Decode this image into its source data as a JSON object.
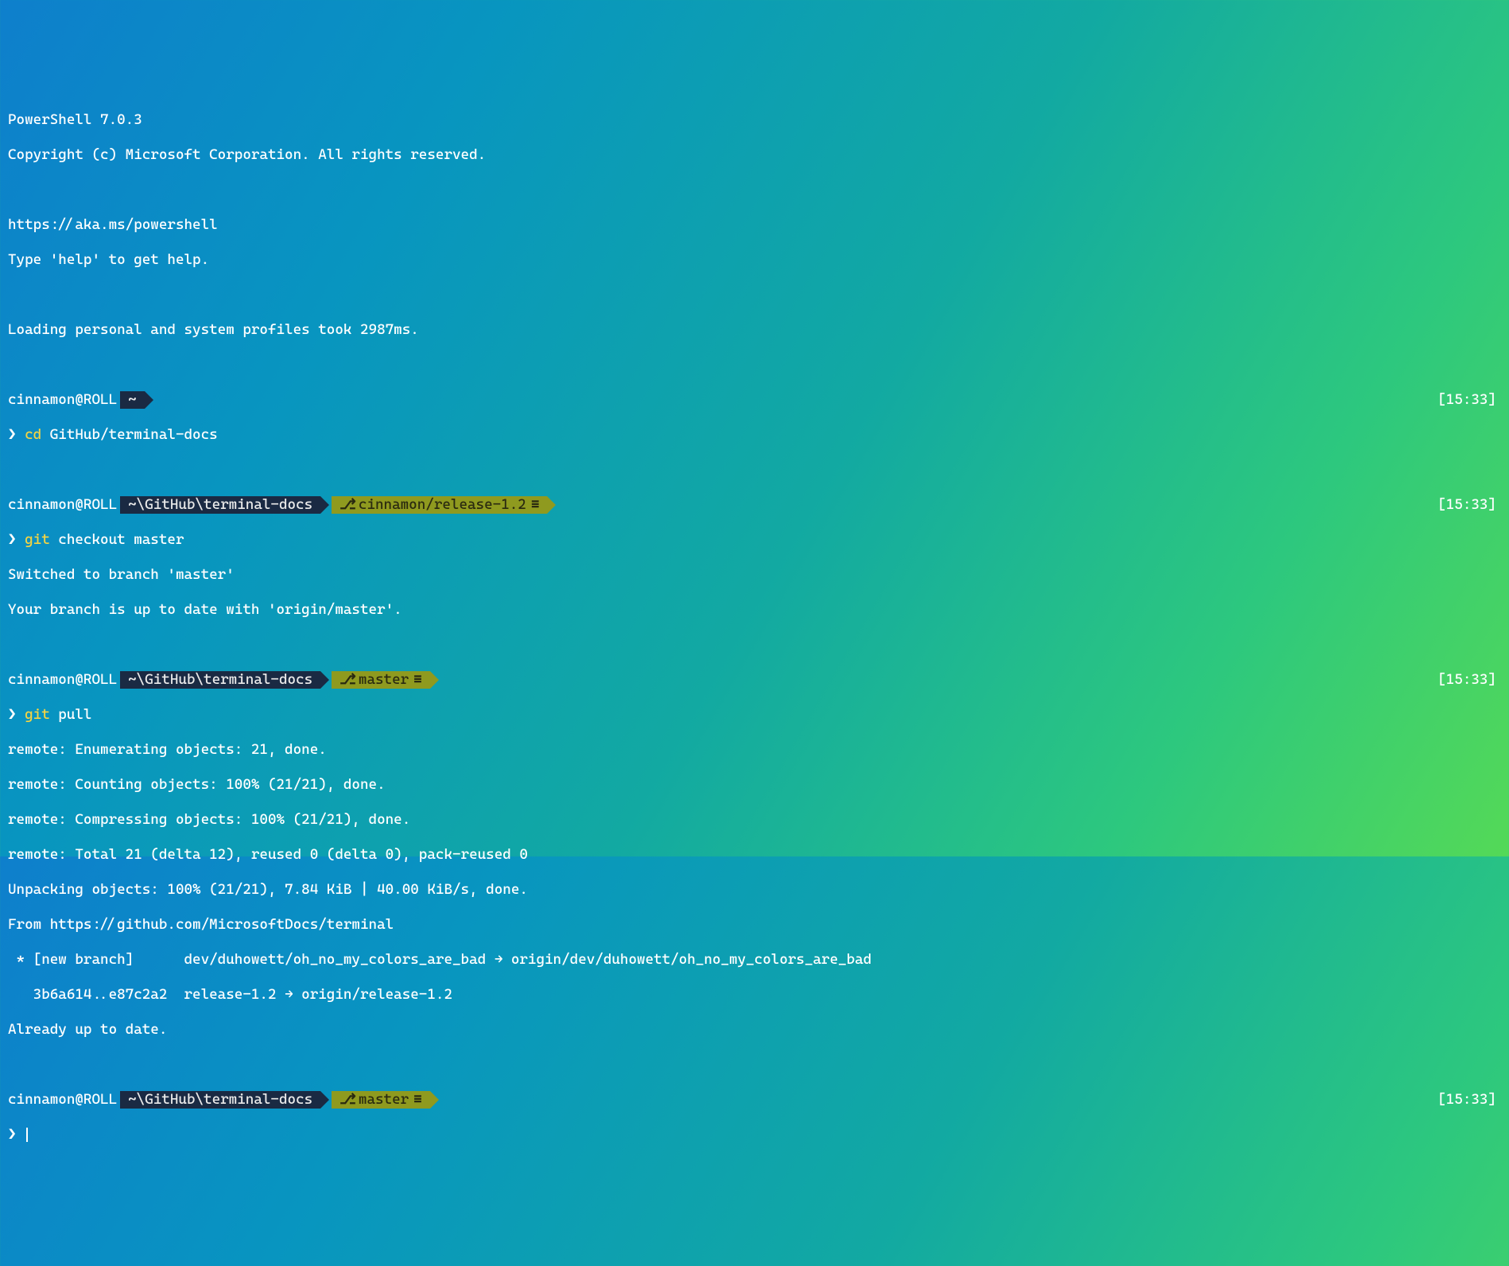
{
  "header": {
    "line1": "PowerShell 7.0.3",
    "line2": "Copyright (c) Microsoft Corporation. All rights reserved.",
    "link": "https://aka.ms/powershell",
    "help": "Type 'help' to get help.",
    "profiles": "Loading personal and system profiles took 2987ms."
  },
  "user_host": "cinnamon@ROLL",
  "timestamps": {
    "t1": "[15:33]",
    "t2": "[15:33]",
    "t3": "[15:33]",
    "t4": "[15:33]"
  },
  "prompts": {
    "p1": {
      "path": "~",
      "branch": null
    },
    "p2": {
      "path": "~\\GitHub\\terminal-docs",
      "branch": "cinnamon/release-1.2"
    },
    "p3": {
      "path": "~\\GitHub\\terminal-docs",
      "branch": "master"
    },
    "p4": {
      "path": "~\\GitHub\\terminal-docs",
      "branch": "master"
    }
  },
  "cmd_marker": "❯",
  "commands": {
    "c1_kw": "cd",
    "c1_rest": " GitHub/terminal-docs",
    "c2_kw": "git",
    "c2_rest": " checkout master",
    "c3_kw": "git",
    "c3_rest": " pull"
  },
  "out_checkout": {
    "l1": "Switched to branch 'master'",
    "l2": "Your branch is up to date with 'origin/master'."
  },
  "out_pull": {
    "l1": "remote: Enumerating objects: 21, done.",
    "l2": "remote: Counting objects: 100% (21/21), done.",
    "l3": "remote: Compressing objects: 100% (21/21), done.",
    "l4": "remote: Total 21 (delta 12), reused 0 (delta 0), pack-reused 0",
    "l5": "Unpacking objects: 100% (21/21), 7.84 KiB | 40.00 KiB/s, done.",
    "l6": "From https://github.com/MicrosoftDocs/terminal",
    "l7": " * [new branch]      dev/duhowett/oh_no_my_colors_are_bad → origin/dev/duhowett/oh_no_my_colors_are_bad",
    "l8": "   3b6a614..e87c2a2  release-1.2 → origin/release-1.2",
    "l9": "Already up to date."
  },
  "icons": {
    "branch": "⎇",
    "clean": "≡"
  }
}
